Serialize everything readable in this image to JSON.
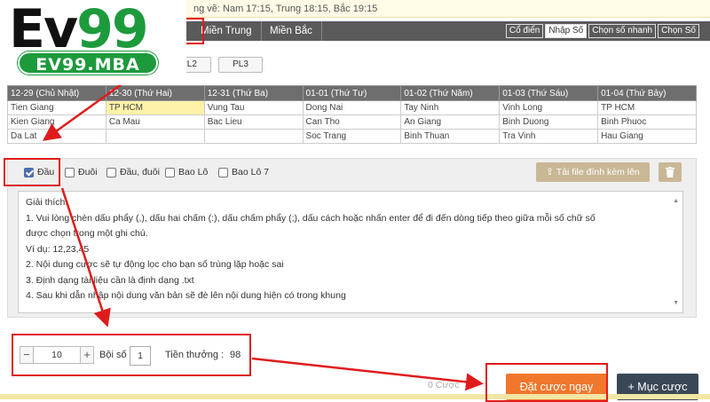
{
  "logo": {
    "main_a": "Ev",
    "main_b": "99",
    "sub": "EV99.MBA"
  },
  "top_info": "ng vẽ: Nam 17:15, Trung 18:15, Bắc 19:15",
  "region_tabs": [
    "Miền Trung",
    "Miền Bắc"
  ],
  "mode_buttons": [
    {
      "label": "Cổ điển",
      "active": false
    },
    {
      "label": "Nhập Số",
      "active": true
    },
    {
      "label": "Chọn số nhanh",
      "active": false
    },
    {
      "label": "Chọn Số",
      "active": false
    }
  ],
  "pl_buttons": [
    "PL2",
    "PL3"
  ],
  "schedule": {
    "headers": [
      "12-29 (Chủ Nhật)",
      "12-30 (Thứ Hai)",
      "12-31 (Thứ Ba)",
      "01-01 (Thứ Tư)",
      "01-02 (Thứ Năm)",
      "01-03 (Thứ Sáu)",
      "01-04 (Thứ Bảy)"
    ],
    "rows": [
      [
        "Tien Giang",
        "TP HCM",
        "Vung Tau",
        "Dong Nai",
        "Tay Ninh",
        "Vinh Long",
        "TP HCM"
      ],
      [
        "Kien Giang",
        "Ca Mau",
        "Bac Lieu",
        "Can Tho",
        "An Giang",
        "Binh Duong",
        "Binh Phuoc"
      ],
      [
        "Da Lat",
        "",
        "",
        "Soc Trang",
        "Binh Thuan",
        "Tra Vinh",
        "Hau Giang"
      ]
    ]
  },
  "options": {
    "checkboxes": [
      {
        "label": "Đầu",
        "checked": true
      },
      {
        "label": "Đuôi",
        "checked": false
      },
      {
        "label": "Đầu, đuôi",
        "checked": false
      },
      {
        "label": "Bao Lô",
        "checked": false
      },
      {
        "label": "Bao Lô 7",
        "checked": false
      }
    ],
    "upload_label": "Tải file đính kèm lên",
    "description": [
      "Giải thích:",
      "1. Vui lòng chèn dấu phẩy (,), dấu hai chấm (:), dấu chấm phẩy (;), dấu cách hoặc nhấn enter để đi đến dòng tiếp theo giữa mỗi số chữ số",
      "được chọn trong một ghi chú.",
      "Ví dụ: 12,23,45",
      "2. Nội dung cược sẽ tự động lọc cho bạn số trùng lặp hoặc sai",
      "3. Định dạng tài liệu cần là định dạng .txt",
      "4. Sau khi dẫn nhập nội dung văn bản sẽ đè lên nội dung hiện có trong khung"
    ]
  },
  "bet": {
    "stepper_value": "10",
    "multiplier_label": "Bội số",
    "multiplier_value": "1",
    "reward_label": "Tiền thưởng :",
    "reward_value": "98",
    "cuoc_text": "0 Cược",
    "bet_now_label": "Đặt cược ngay",
    "add_item_label": "+ Mục cược"
  },
  "colors": {
    "accent_orange": "#f0772b",
    "dark_button": "#3a4756",
    "annotation_red": "#e01b1b",
    "logo_green": "#1d9a3c"
  }
}
